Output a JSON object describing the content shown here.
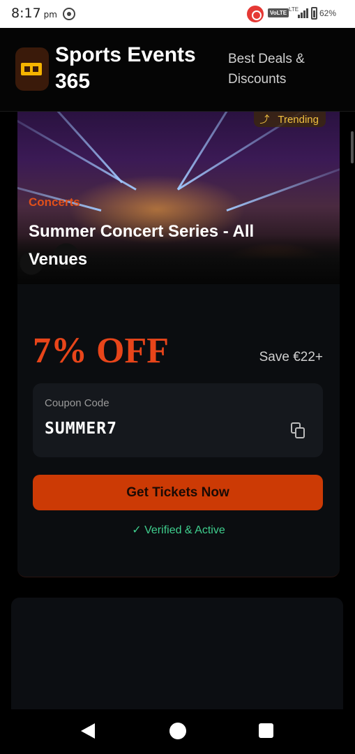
{
  "status_bar": {
    "time": "8:17",
    "ampm": "pm",
    "network_badge": "VoLTE",
    "network_type": "LTE",
    "battery": "62%"
  },
  "header": {
    "title": "Sports Events 365",
    "tagline": "Best Deals & Discounts",
    "logo_icon": "ticket-icon"
  },
  "hero": {
    "badge_label": "Trending",
    "badge_icon": "trending-up-icon",
    "category": "Concerts",
    "title": "Summer Concert Series - All Venues"
  },
  "offer": {
    "discount": "7% OFF",
    "savings": "Save €22+",
    "coupon_label": "Coupon Code",
    "coupon_code": "SUMMER7",
    "copy_icon": "copy-icon",
    "cta_label": "Get Tickets Now",
    "verified_label": "✓ Verified & Active"
  },
  "colors": {
    "accent": "#e8451a",
    "button": "#cc3a05",
    "verified": "#3fcf8e",
    "trending": "#f0c040"
  }
}
